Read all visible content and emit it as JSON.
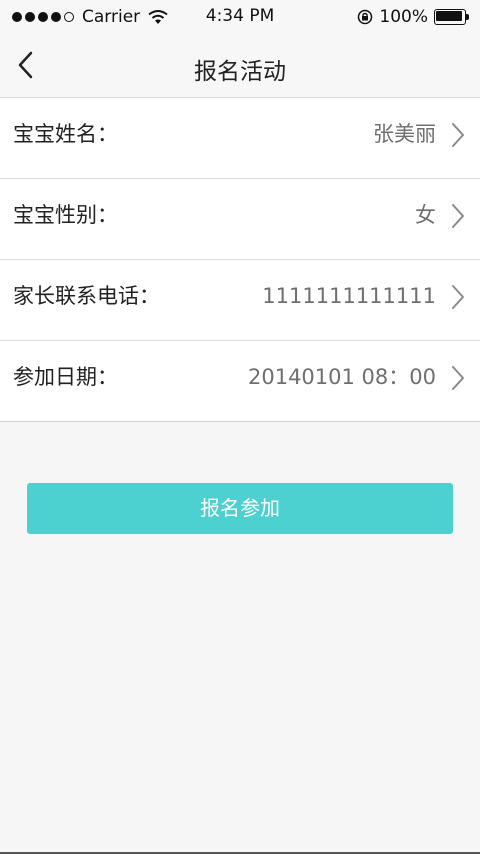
{
  "status_bar": {
    "carrier": "Carrier",
    "time": "4:34 PM",
    "battery": "100%",
    "signal_icon": "signal-dots-icon",
    "wifi_icon": "wifi-icon",
    "lock_icon": "rotation-lock-icon",
    "battery_icon": "battery-icon"
  },
  "nav": {
    "title": "报名活动",
    "back_icon": "chevron-left-icon"
  },
  "form": {
    "rows": [
      {
        "label": "宝宝姓名：",
        "value": "张美丽"
      },
      {
        "label": "宝宝性别：",
        "value": "女"
      },
      {
        "label": "家长联系电话：",
        "value": "1111111111111"
      },
      {
        "label": "参加日期：",
        "value": "20140101 08：00"
      }
    ],
    "row_icon": "chevron-right-icon"
  },
  "submit": {
    "label": "报名参加"
  },
  "colors": {
    "accent": "#4dd0d0",
    "background": "#f6f6f6",
    "value_text": "#6f6f6f"
  }
}
